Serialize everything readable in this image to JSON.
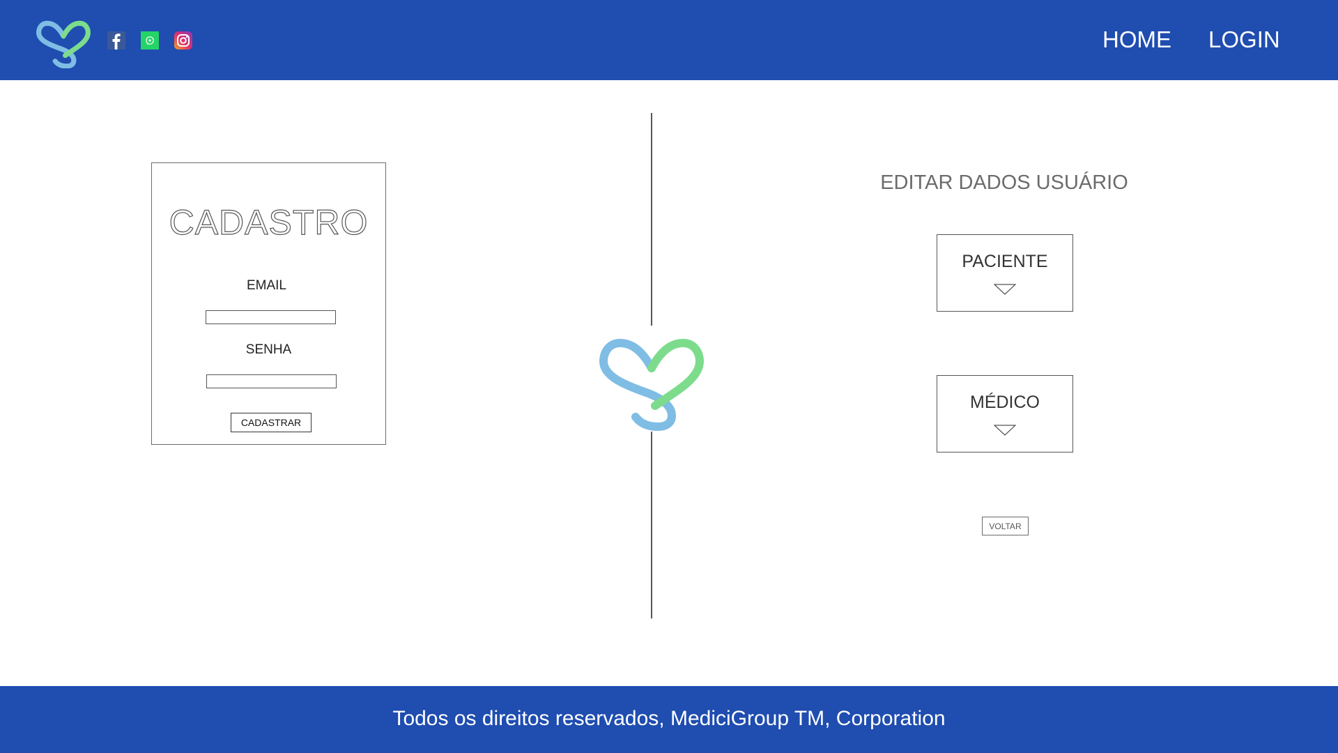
{
  "header": {
    "nav": {
      "home": "HOME",
      "login": "LOGIN"
    },
    "social_icons": [
      "facebook-icon",
      "whatsapp-icon",
      "instagram-icon"
    ]
  },
  "register": {
    "title": "CADASTRO",
    "email_label": "EMAIL",
    "email_value": "",
    "password_label": "SENHA",
    "password_value": "",
    "submit_label": "CADASTRAR"
  },
  "edit_user": {
    "title": "EDITAR DADOS USUÁRIO",
    "options": [
      {
        "label": "PACIENTE"
      },
      {
        "label": "MÉDICO"
      }
    ],
    "back_label": "VOLTAR"
  },
  "footer": {
    "text": "Todos os direitos reservados, MediciGroup TM, Corporation"
  },
  "colors": {
    "brand_blue": "#1f4db0",
    "logo_blue": "#7fbde4",
    "logo_green": "#7cdc8c",
    "facebook": "#3b5998",
    "whatsapp": "#25d366"
  }
}
